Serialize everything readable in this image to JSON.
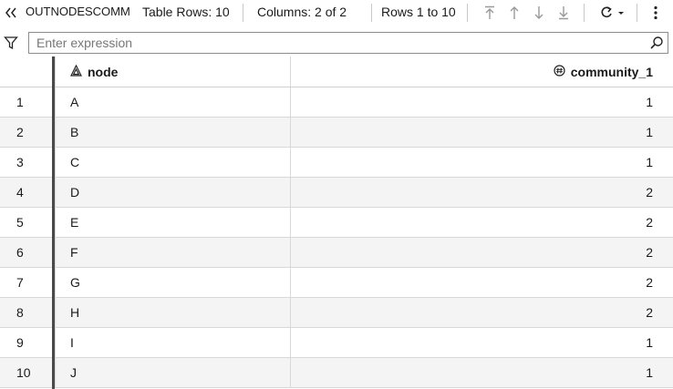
{
  "toolbar": {
    "table_name": "OUTNODESCOMM",
    "table_rows": "Table Rows: 10",
    "columns": "Columns: 2 of 2",
    "rows_range": "Rows 1 to 10"
  },
  "filter": {
    "placeholder": "Enter expression",
    "value": ""
  },
  "columns": [
    {
      "label": "node",
      "type_icon": "character-type-icon"
    },
    {
      "label": "community_1",
      "type_icon": "numeric-type-icon"
    }
  ],
  "rows": [
    {
      "num": "1",
      "node": "A",
      "community": "1"
    },
    {
      "num": "2",
      "node": "B",
      "community": "1"
    },
    {
      "num": "3",
      "node": "C",
      "community": "1"
    },
    {
      "num": "4",
      "node": "D",
      "community": "2"
    },
    {
      "num": "5",
      "node": "E",
      "community": "2"
    },
    {
      "num": "6",
      "node": "F",
      "community": "2"
    },
    {
      "num": "7",
      "node": "G",
      "community": "2"
    },
    {
      "num": "8",
      "node": "H",
      "community": "2"
    },
    {
      "num": "9",
      "node": "I",
      "community": "1"
    },
    {
      "num": "10",
      "node": "J",
      "community": "1"
    }
  ]
}
